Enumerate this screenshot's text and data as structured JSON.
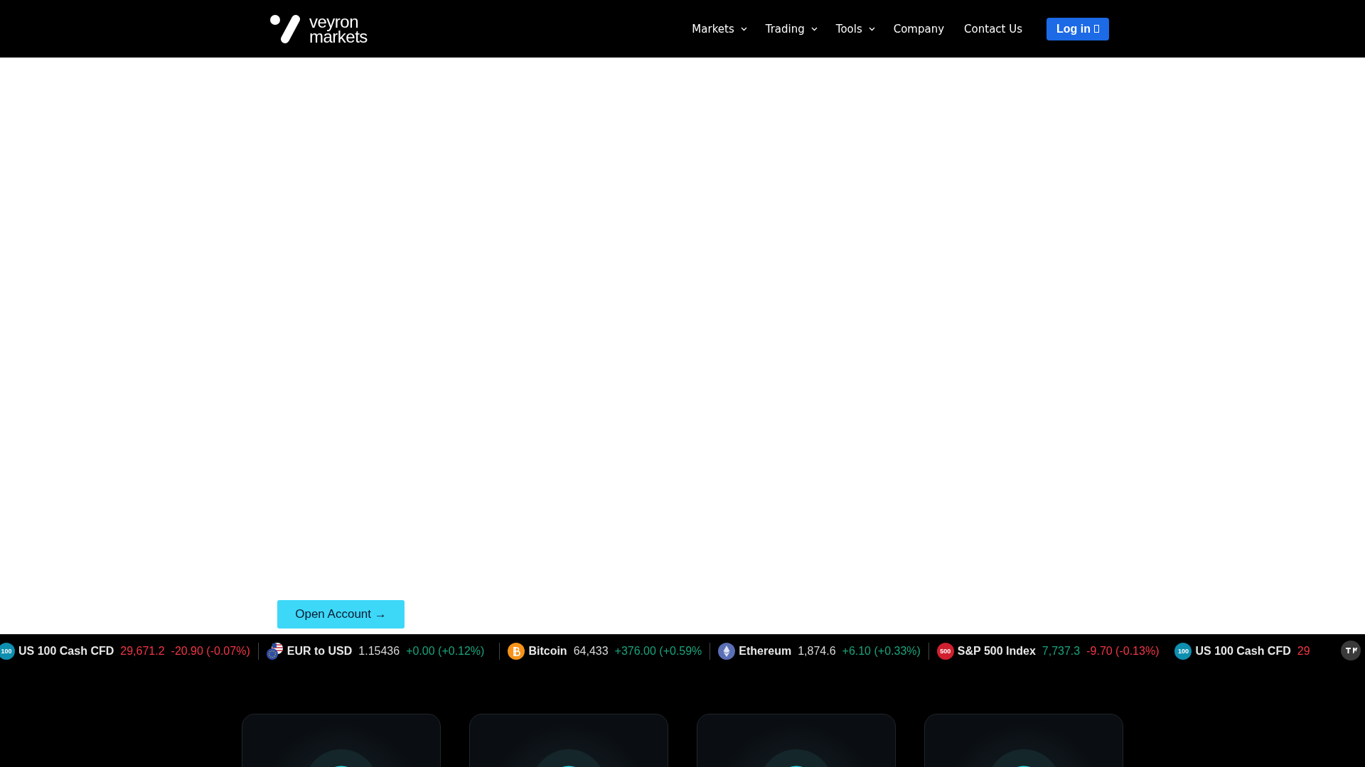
{
  "header": {
    "logo": {
      "line1": "veyron",
      "line2": "markets"
    },
    "nav": [
      {
        "label": "Markets",
        "dropdown": true
      },
      {
        "label": "Trading",
        "dropdown": true
      },
      {
        "label": "Tools",
        "dropdown": true
      },
      {
        "label": "Company",
        "dropdown": false
      },
      {
        "label": "Contact Us",
        "dropdown": false
      }
    ],
    "login": "Log in"
  },
  "hero": {
    "cta": "Open Account →"
  },
  "ticker": [
    {
      "kind": "badge",
      "badge": "100",
      "name": "US 100 Cash CFD",
      "price": {
        "text": "29,671.2",
        "color": "#f23645"
      },
      "change": {
        "text": "-20.90 (-0.07%)",
        "color": "#f23645"
      }
    },
    {
      "kind": "flags",
      "name": "EUR to USD",
      "price": {
        "text": "1.15436",
        "color": "#d8d8d8"
      },
      "change": {
        "text": "+0.00 (+0.12%)",
        "color": "#1aa37a"
      }
    },
    {
      "kind": "bitcoin",
      "name": "Bitcoin",
      "price": {
        "text": "64,433",
        "color": "#d8d8d8"
      },
      "change": {
        "text": "+376.00 (+0.59%",
        "color": "#1aa37a"
      }
    },
    {
      "kind": "ethereum",
      "name": "Ethereum",
      "price": {
        "text": "1,874.6",
        "color": "#d8d8d8"
      },
      "change": {
        "text": "+6.10 (+0.33%)",
        "color": "#1aa37a"
      }
    },
    {
      "kind": "badge",
      "badge": "500",
      "name": "S&P 500 Index",
      "price": {
        "text": "7,737.3",
        "color": "#1aa37a"
      },
      "change": {
        "text": "-9.70 (-0.13%)",
        "color": "#f23645"
      }
    },
    {
      "kind": "badge",
      "badge": "100",
      "name": "US 100 Cash CFD",
      "price": {
        "text": "29",
        "color": "#f23645"
      }
    }
  ],
  "cards": [
    {
      "kind": "feature"
    },
    {
      "kind": "feature"
    },
    {
      "kind": "feature"
    },
    {
      "kind": "feature"
    }
  ]
}
